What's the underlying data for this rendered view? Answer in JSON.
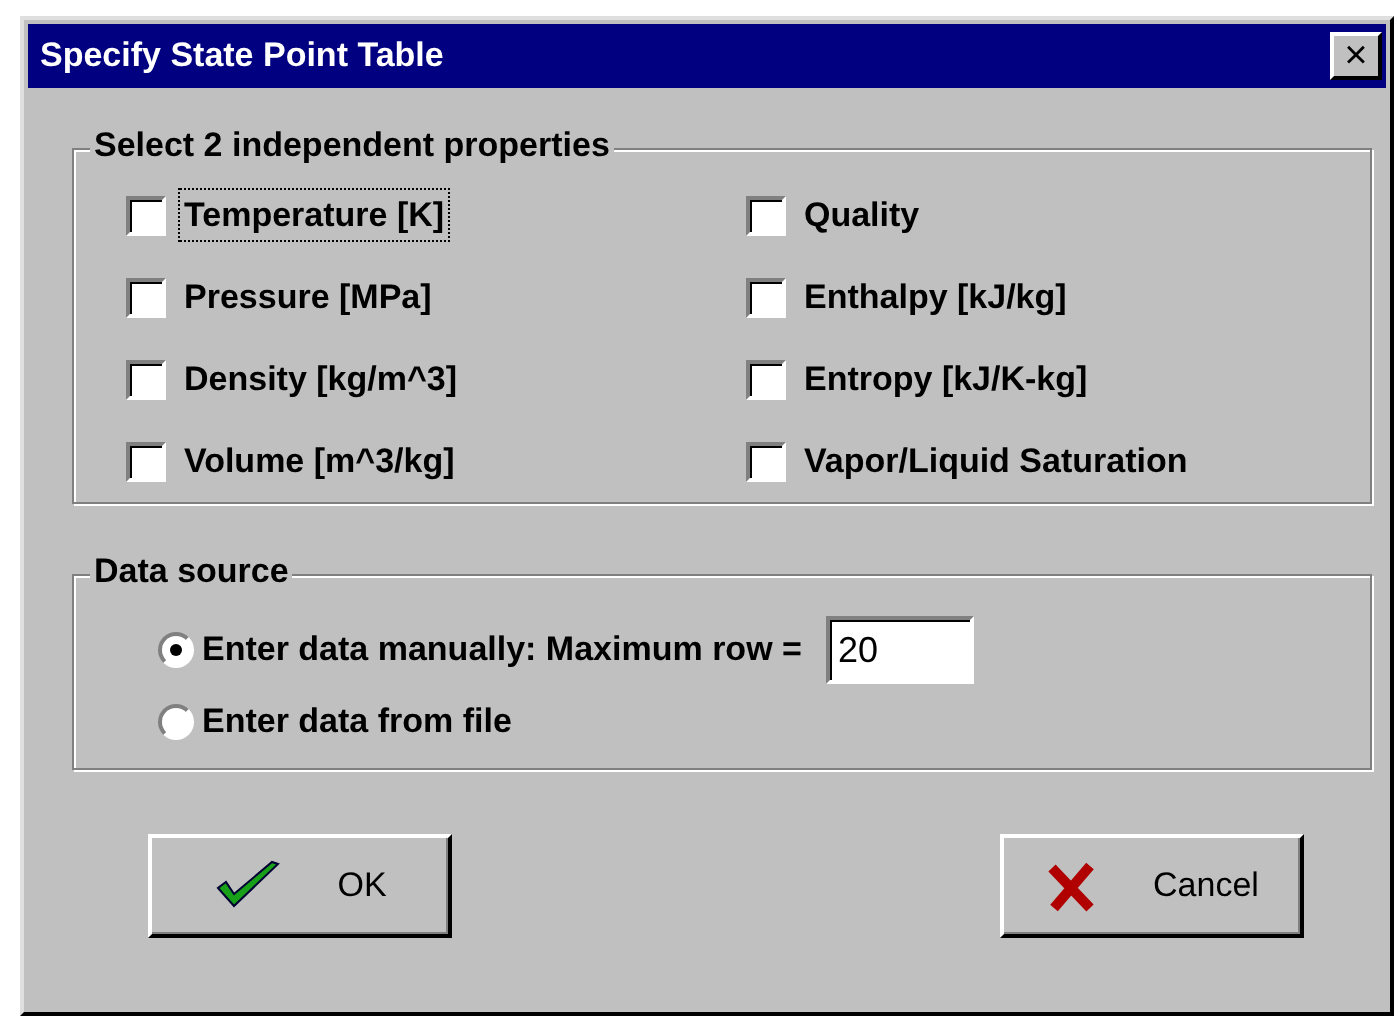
{
  "window": {
    "title": "Specify State Point Table",
    "close": "×"
  },
  "properties": {
    "title": "Select 2 independent properties",
    "items": [
      {
        "label": "Temperature [K]",
        "checked": false,
        "focused": true
      },
      {
        "label": "Pressure [MPa]",
        "checked": false,
        "focused": false
      },
      {
        "label": "Density [kg/m^3]",
        "checked": false,
        "focused": false
      },
      {
        "label": "Volume [m^3/kg]",
        "checked": false,
        "focused": false
      },
      {
        "label": "Quality",
        "checked": false,
        "focused": false
      },
      {
        "label": "Enthalpy [kJ/kg]",
        "checked": false,
        "focused": false
      },
      {
        "label": "Entropy [kJ/K-kg]",
        "checked": false,
        "focused": false
      },
      {
        "label": "Vapor/Liquid Saturation",
        "checked": false,
        "focused": false
      }
    ]
  },
  "data_source": {
    "title": "Data source",
    "options": [
      {
        "label": "Enter data manually: Maximum row =",
        "selected": true,
        "value": "20"
      },
      {
        "label": "Enter data from file",
        "selected": false
      }
    ]
  },
  "buttons": [
    {
      "kind": "ok",
      "label": "OK"
    },
    {
      "kind": "cancel",
      "label": "Cancel"
    }
  ]
}
